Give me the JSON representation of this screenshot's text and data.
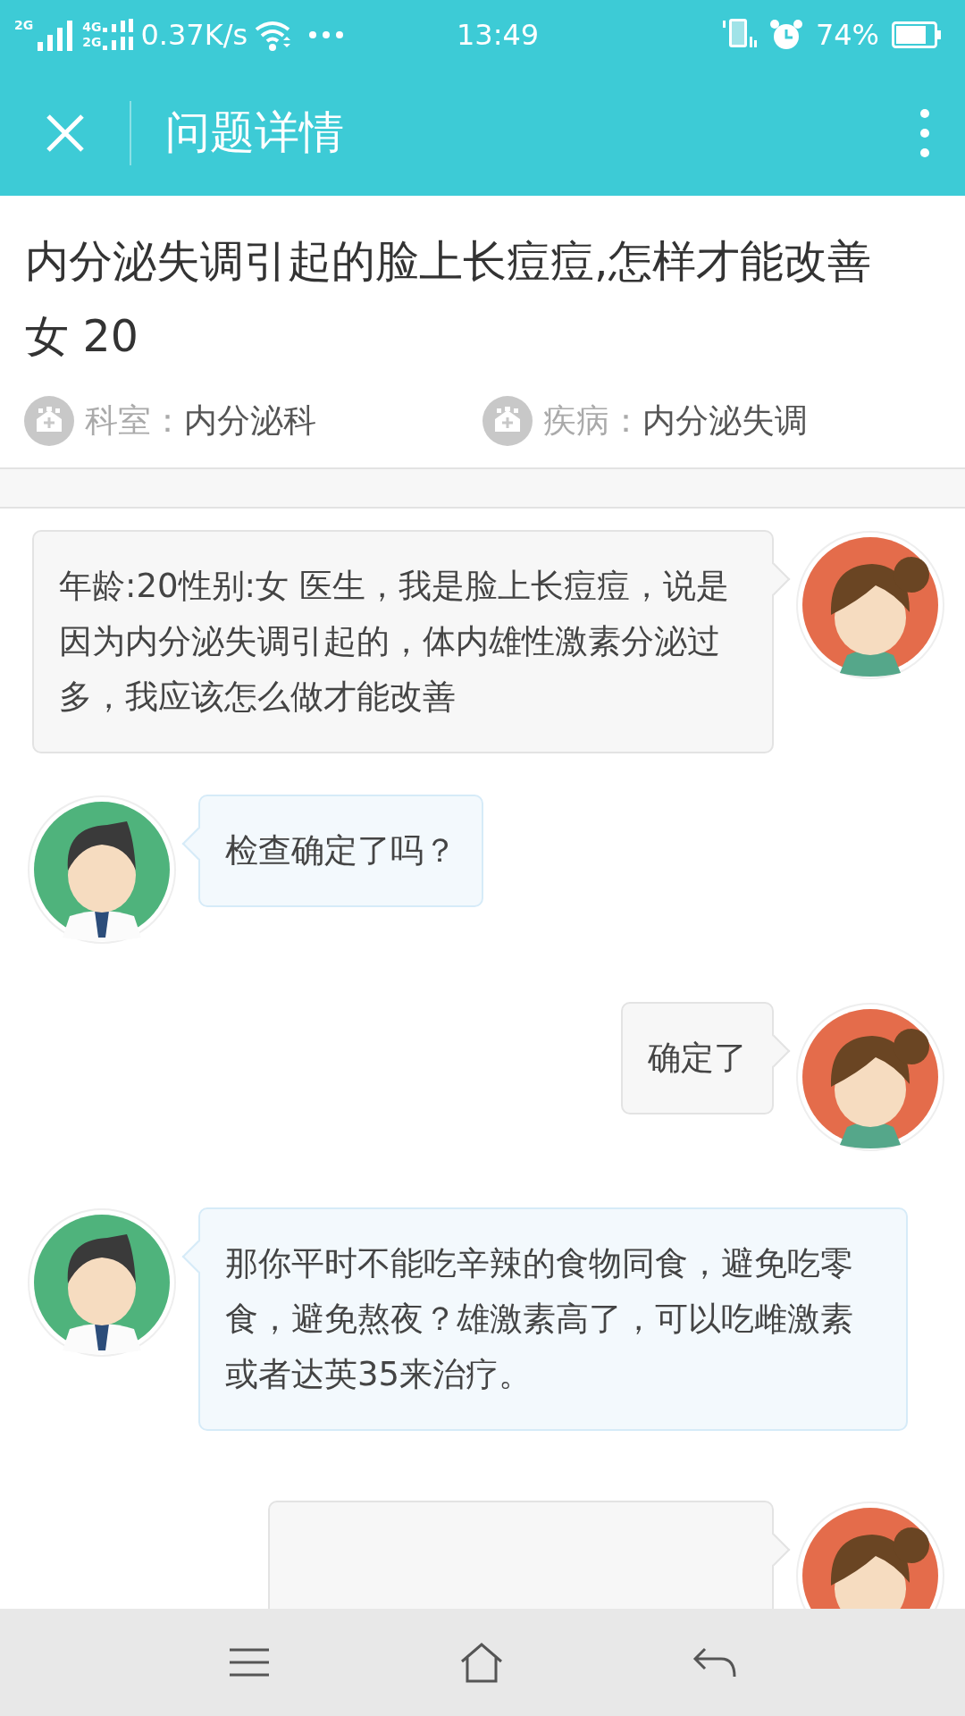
{
  "status_bar": {
    "signal_1": "2G",
    "signal_2_top": "4G",
    "signal_2_bottom": "2G",
    "speed": "0.37K/s",
    "time": "13:49",
    "battery": "74%"
  },
  "header": {
    "title": "问题详情"
  },
  "question": {
    "title": "内分泌失调引起的脸上长痘痘,怎样才能改善",
    "patient_info": "女 20",
    "meta": [
      {
        "label": "科室：",
        "value": "内分泌科"
      },
      {
        "label": "疾病：",
        "value": "内分泌失调"
      }
    ]
  },
  "messages": [
    {
      "kind": "patient",
      "text": "年龄:20性别:女 医生，我是脸上长痘痘，说是因为内分泌失调引起的，体内雄性激素分泌过多，我应该怎么做才能改善"
    },
    {
      "kind": "doctor",
      "text": "检查确定了吗？"
    },
    {
      "kind": "patient",
      "text": "确定了"
    },
    {
      "kind": "doctor",
      "text": "那你平时不能吃辛辣的食物同食，避免吃零食，避免熬夜？雄激素高了，可以吃雌激素或者达英35来治疗。"
    },
    {
      "kind": "patient"
    }
  ]
}
